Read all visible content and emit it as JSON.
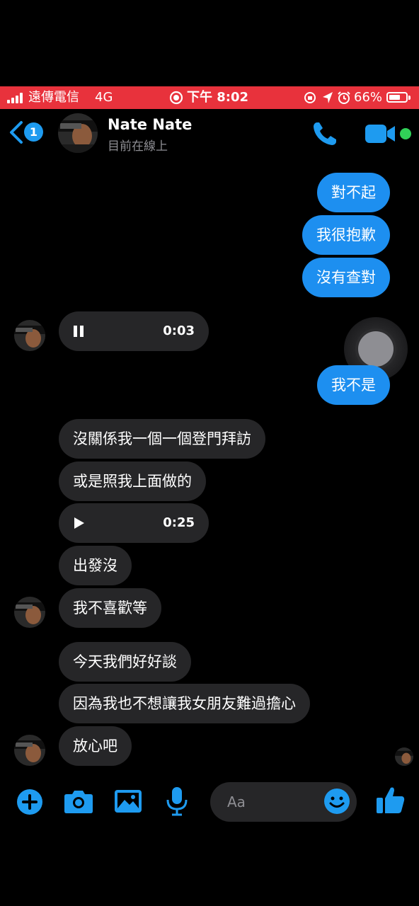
{
  "status_bar": {
    "carrier": "遠傳電信",
    "network": "4G",
    "time": "下午 8:02",
    "battery": "66%",
    "battery_level": 0.66,
    "background_color": "#e8323c"
  },
  "header": {
    "back_badge": "1",
    "contact_name": "Nate Nate",
    "contact_status": "目前在線上",
    "accent_color": "#1e9bf0",
    "online_color": "#31d158"
  },
  "messages": [
    {
      "from": "me",
      "text": "對不起"
    },
    {
      "from": "me",
      "text": "我很抱歉"
    },
    {
      "from": "me",
      "text": "沒有查對"
    },
    {
      "from": "them",
      "type": "audio",
      "duration": "0:03",
      "state": "playing"
    },
    {
      "from": "me",
      "text": "我不是"
    },
    {
      "from": "them",
      "text": "沒關係我一個一個登門拜訪"
    },
    {
      "from": "them",
      "text": "或是照我上面做的"
    },
    {
      "from": "them",
      "type": "audio",
      "duration": "0:25",
      "state": "paused"
    },
    {
      "from": "them",
      "text": "出發沒"
    },
    {
      "from": "them",
      "text": "我不喜歡等"
    },
    {
      "from": "them",
      "text": "今天我們好好談"
    },
    {
      "from": "them",
      "text": "因為我也不想讓我女朋友難過擔心"
    },
    {
      "from": "them",
      "text": "放心吧"
    }
  ],
  "composer": {
    "placeholder": "Aa"
  },
  "colors": {
    "outgoing_bubble": "#1d8ff0",
    "incoming_bubble": "#262628",
    "icon_blue": "#1e9bf0"
  },
  "icons": [
    "signal-icon",
    "record-icon",
    "lock-rotation-icon",
    "location-icon",
    "alarm-icon",
    "battery-icon",
    "back-chevron-icon",
    "phone-icon",
    "video-icon",
    "play-icon",
    "pause-icon",
    "add-icon",
    "camera-icon",
    "gallery-icon",
    "microphone-icon",
    "emoji-icon",
    "like-icon"
  ]
}
